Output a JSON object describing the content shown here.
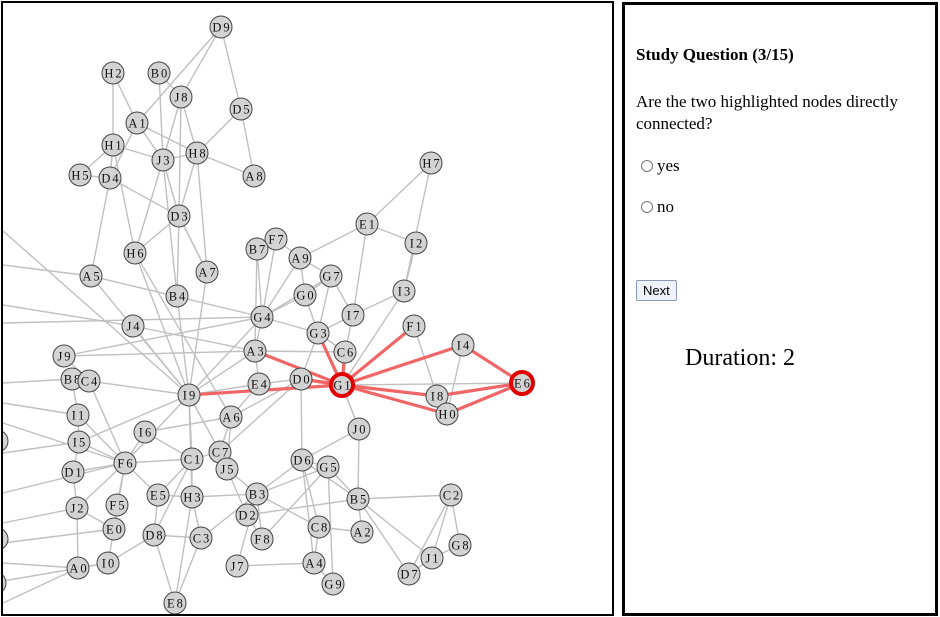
{
  "question": {
    "title": "Study Question (3/15)",
    "text": "Are the two highlighted nodes directly connected?",
    "options": [
      "yes",
      "no"
    ],
    "next_label": "Next",
    "duration_label": "Duration:",
    "duration_value": "2"
  },
  "graph": {
    "highlighted_nodes": [
      "G1",
      "E6"
    ],
    "nodes": [
      "D9",
      "H2",
      "B0",
      "J8",
      "D5",
      "A1",
      "H1",
      "J3",
      "H8",
      "H5",
      "D4",
      "A8",
      "H7",
      "D3",
      "E1",
      "I2",
      "F7",
      "B7",
      "A9",
      "H6",
      "G7",
      "A5",
      "A7",
      "B4",
      "G0",
      "I3",
      "G4",
      "I7",
      "J4",
      "F1",
      "G3",
      "I4",
      "A3",
      "C6",
      "J9",
      "B8",
      "C4",
      "D0",
      "E4",
      "G1",
      "E6",
      "I9",
      "I8",
      "H0",
      "I1",
      "A6",
      "J0",
      "I6",
      "I5",
      "C7",
      "F6",
      "C1",
      "D6",
      "G5",
      "D1",
      "J5",
      "E5",
      "H3",
      "B3",
      "C2",
      "B5",
      "J2",
      "F5",
      "D2",
      "E0",
      "D8",
      "C3",
      "C8",
      "F8",
      "A2",
      "I0",
      "J1",
      "G8",
      "A0",
      "J7",
      "A4",
      "D7",
      "G9",
      "E8"
    ],
    "edge_color": "#c0c0c0",
    "highlight_edge_color": "#f06666",
    "highlight_node_color": "#e00000",
    "node_fill": "#d3d3d3"
  }
}
